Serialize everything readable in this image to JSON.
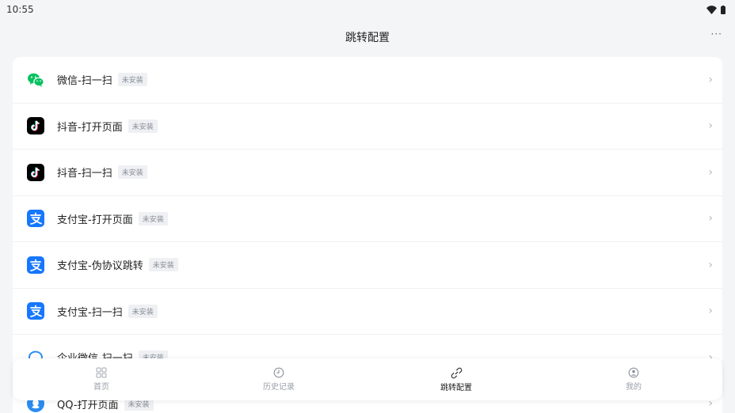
{
  "status": {
    "time": "10:55"
  },
  "header": {
    "title": "跳转配置",
    "more": "···"
  },
  "list": {
    "chevron": "›",
    "items": [
      {
        "label": "微信-扫一扫",
        "badge": "未安装",
        "icon": "wechat-icon"
      },
      {
        "label": "抖音-打开页面",
        "badge": "未安装",
        "icon": "tiktok-icon"
      },
      {
        "label": "抖音-扫一扫",
        "badge": "未安装",
        "icon": "tiktok-icon"
      },
      {
        "label": "支付宝-打开页面",
        "badge": "未安装",
        "icon": "alipay-icon"
      },
      {
        "label": "支付宝-伪协议跳转",
        "badge": "未安装",
        "icon": "alipay-icon"
      },
      {
        "label": "支付宝-扫一扫",
        "badge": "未安装",
        "icon": "alipay-icon"
      },
      {
        "label": "企业微信-扫一扫",
        "badge": "未安装",
        "icon": "wework-icon"
      },
      {
        "label": "QQ-打开页面",
        "badge": "未安装",
        "icon": "qq-icon"
      }
    ]
  },
  "tabbar": {
    "tabs": [
      {
        "label": "首页",
        "icon": "home-grid-icon"
      },
      {
        "label": "历史记录",
        "icon": "clock-icon"
      },
      {
        "label": "跳转配置",
        "icon": "link-icon",
        "active": true
      },
      {
        "label": "我的",
        "icon": "user-icon"
      }
    ]
  },
  "colors": {
    "wechat": "#07c160",
    "alipay": "#1677ff",
    "qq": "#2a8cf0",
    "tiktok": "#000000"
  }
}
